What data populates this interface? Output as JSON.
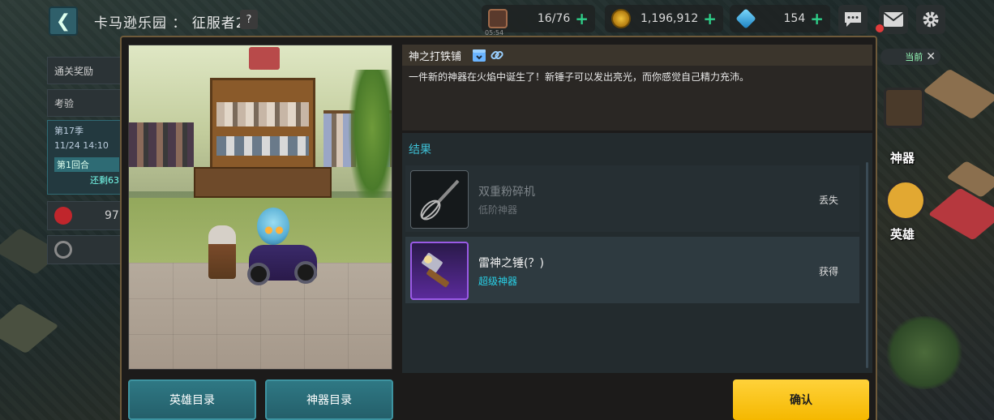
{
  "header": {
    "back_glyph": "❮",
    "title": "卡马逊乐园 ： 征服者2",
    "help": "?"
  },
  "resources": [
    {
      "icon": "coffee-icon",
      "value": "16/76",
      "sub": "05:54",
      "color": "#7a4a3a"
    },
    {
      "icon": "coin-icon",
      "value": "1,196,912",
      "color": "#d19a1a"
    },
    {
      "icon": "gem-icon",
      "value": "154",
      "color": "#2aa7e0"
    }
  ],
  "side_panel": {
    "clear_reward": "通关奖励",
    "exam": "考验",
    "season": "第17季",
    "date": "11/24 14:10",
    "round": "第1回合",
    "remaining": "还剩63",
    "stat_value": "97"
  },
  "right_labels": {
    "artifact": "神器",
    "hero": "英雄",
    "current": "当前"
  },
  "event": {
    "title": "神之打铁铺",
    "description": "一件新的神器在火焰中诞生了！新锤子可以发出亮光，而你感觉自己精力充沛。"
  },
  "results": {
    "label": "结果",
    "items": [
      {
        "name": "双重粉碎机",
        "tier": "低阶神器",
        "state": "丢失",
        "icon": "whisk-icon"
      },
      {
        "name": "雷神之锤(？)",
        "tier": "超级神器",
        "state": "获得",
        "icon": "hammer-icon"
      }
    ]
  },
  "buttons": {
    "hero_catalog": "英雄目录",
    "artifact_catalog": "神器目录",
    "confirm": "确认"
  },
  "colors": {
    "accent_teal": "#3ec0d6",
    "confirm_yellow": "#f5b800",
    "super_tier": "#29d0e6",
    "modal_border": "#6e5a3a"
  }
}
